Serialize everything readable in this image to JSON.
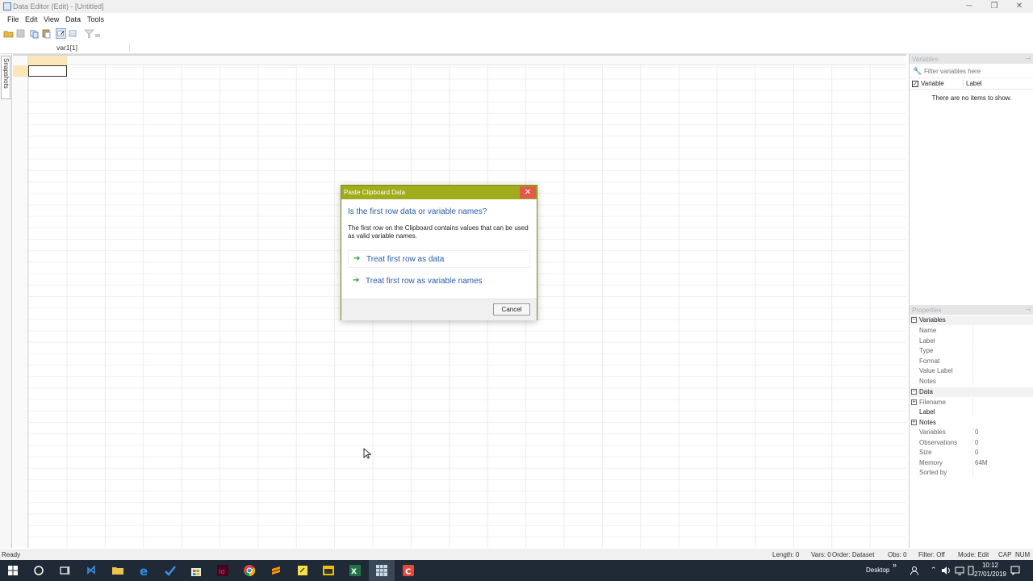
{
  "window": {
    "title": "Data Editor (Edit) - [Untitled]",
    "minimize": "─",
    "restore": "❐",
    "close": "✕"
  },
  "menu": {
    "file": "File",
    "edit": "Edit",
    "view": "View",
    "data": "Data",
    "tools": "Tools"
  },
  "cellbar": {
    "ref": "var1[1]"
  },
  "snapshots": {
    "label": "Snapshots"
  },
  "variables_panel": {
    "title": "Variables",
    "filter_placeholder": "Filter variables here",
    "col_variable": "Variable",
    "col_label": "Label",
    "empty_message": "There are no items to show."
  },
  "properties_panel": {
    "title": "Properties",
    "variables_section": "Variables",
    "var_rows": [
      "Name",
      "Label",
      "Type",
      "Format",
      "Value Label",
      "Notes"
    ],
    "data_section": "Data",
    "filename": "Filename",
    "label": "Label",
    "notes": "Notes",
    "variables_key": "Variables",
    "variables_val": "0",
    "observations_key": "Observations",
    "observations_val": "0",
    "size_key": "Size",
    "size_val": "0",
    "memory_key": "Memory",
    "memory_val": "64M",
    "sorted_key": "Sorted by",
    "sorted_val": ""
  },
  "status": {
    "ready": "Ready",
    "length": "Length: 0",
    "vars": "Vars: 0",
    "order": "Order: Dataset",
    "obs": "Obs: 0",
    "filter": "Filter: Off",
    "mode": "Mode: Edit",
    "cap": "CAP",
    "num": "NUM"
  },
  "dialog": {
    "title": "Paste Clipboard Data",
    "close": "✕",
    "question": "Is the first row data or variable names?",
    "message": "The first row on the Clipboard contains values that can be used as valid variable names.",
    "option1": "Treat first row as data",
    "option2": "Treat first row as variable names",
    "cancel": "Cancel"
  },
  "taskbar": {
    "desktop": "Desktop",
    "time": "10:12",
    "date": "27/01/2019",
    "more": "»"
  }
}
